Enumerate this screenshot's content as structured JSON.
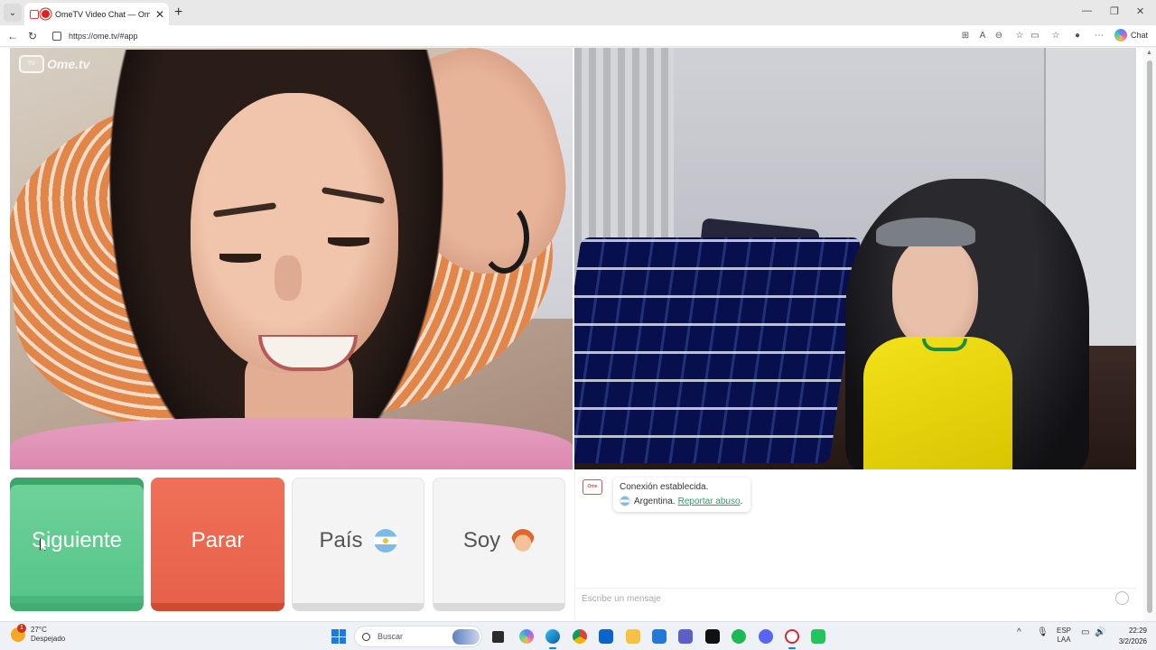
{
  "browser": {
    "tab_title": "OmeTV Video Chat — Omegle",
    "url": "https://ome.tv/#app",
    "copilot_label": "Chat"
  },
  "app": {
    "logo_text": "Ome.tv",
    "buttons": {
      "next": "Siguiente",
      "stop": "Parar",
      "country": "País",
      "iam": "Soy"
    }
  },
  "chat": {
    "status_message": "Conexión establecida.",
    "country": "Argentina.",
    "report_link": "Reportar abuso",
    "report_suffix": ".",
    "input_placeholder": "Escribe un mensaje"
  },
  "taskbar": {
    "weather_temp": "27°C",
    "weather_desc": "Despejado",
    "weather_badge": "1",
    "search_placeholder": "Buscar",
    "lang_line1": "ESP",
    "lang_line2": "LAA",
    "time": "22:29",
    "date": "3/2/2026"
  },
  "colors": {
    "next_button": "#5cc98c",
    "stop_button": "#ea664f",
    "report_link": "#2f9a6b"
  }
}
